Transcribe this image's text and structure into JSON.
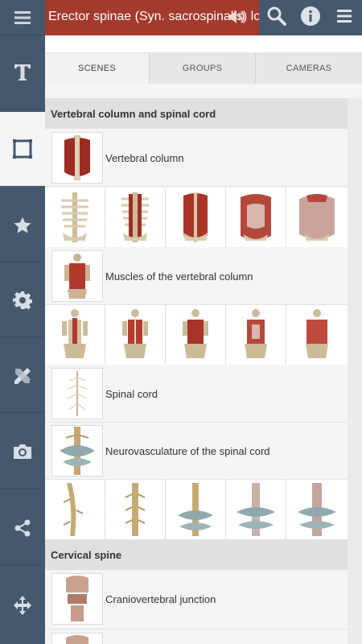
{
  "topbar": {
    "title": "Erector spinae (Syn. sacrospinalis) longissimus",
    "title_bg": "#a23a2d",
    "bar_color": "#46586c",
    "icons": [
      "menu-icon",
      "sound-icon",
      "search-icon",
      "info-icon",
      "overflow-menu-icon"
    ]
  },
  "sidebar": {
    "items": [
      {
        "icon": "text-icon",
        "active": false
      },
      {
        "icon": "frame-icon",
        "active": true
      },
      {
        "icon": "star-icon",
        "active": false
      },
      {
        "icon": "gear-icon",
        "active": false
      },
      {
        "icon": "pencil-ruler-icon",
        "active": false
      },
      {
        "icon": "camera-icon",
        "active": false
      },
      {
        "icon": "share-icon",
        "active": false
      },
      {
        "icon": "move-icon",
        "active": false
      }
    ]
  },
  "tabs": [
    {
      "label": "SCENES",
      "active": true
    },
    {
      "label": "GROUPS",
      "active": false
    },
    {
      "label": "CAMERAS",
      "active": false
    }
  ],
  "sections": [
    {
      "header": "Vertebral column and spinal cord",
      "scenes": [
        {
          "label": "Vertebral column",
          "variants": 5
        },
        {
          "label": "Muscles of the vertebral column",
          "variants": 5
        },
        {
          "label": "Spinal cord",
          "variants": 0
        },
        {
          "label": "Neurovasculature of the spinal cord",
          "variants": 5
        }
      ]
    },
    {
      "header": "Cervical spine",
      "scenes": [
        {
          "label": "Craniovertebral junction",
          "variants": 0
        }
      ]
    }
  ]
}
